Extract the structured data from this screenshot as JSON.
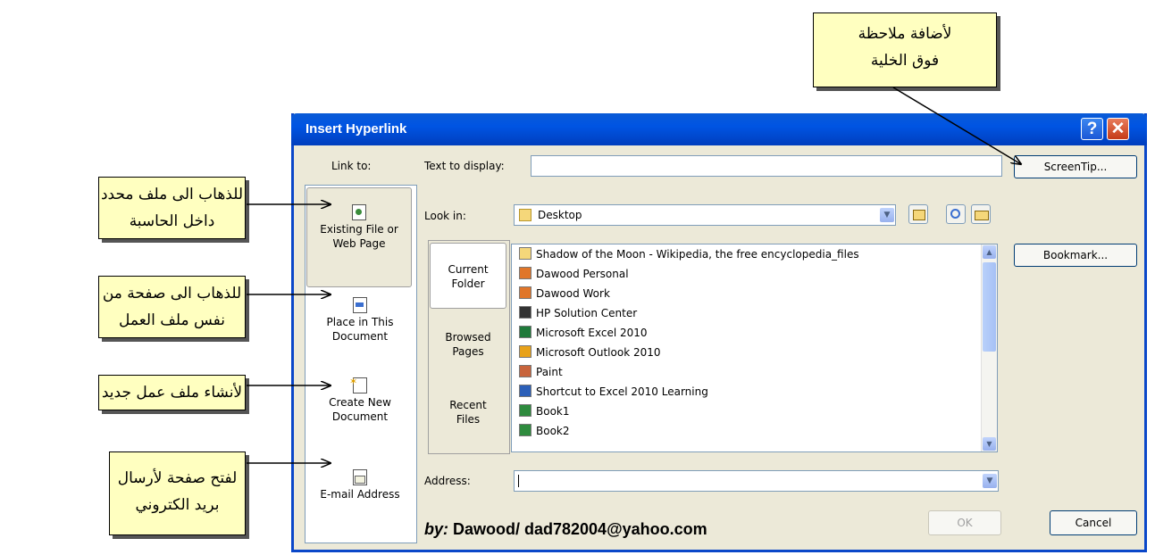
{
  "callouts": {
    "screentip": [
      "لأضافة ملاحظة",
      "فوق الخلية"
    ],
    "existing_file": [
      "للذهاب الى ملف محدد",
      "داخل الحاسبة"
    ],
    "place_in_doc": [
      "للذهاب الى صفحة من",
      "نفس ملف العمل"
    ],
    "new_doc": [
      "لأنشاء ملف عمل جديد"
    ],
    "email": [
      "لفتح صفحة لأرسال",
      "بريد الكتروني"
    ]
  },
  "dialog": {
    "title": "Insert Hyperlink",
    "help_glyph": "?",
    "close_glyph": "✕",
    "link_to_label": "Link to:",
    "text_to_display_label": "Text to display:",
    "text_to_display_value": "",
    "screentip_button": "ScreenTip...",
    "look_in_label": "Look in:",
    "look_in_value": "Desktop",
    "bookmark_button": "Bookmark...",
    "address_label": "Address:",
    "address_value": "",
    "ok_button": "OK",
    "cancel_button": "Cancel",
    "signature_prefix": "by:",
    "signature_text": " Dawood/ dad782004@yahoo.com",
    "sidebar": [
      {
        "line1": "Existing File or",
        "line2": "Web Page",
        "icon": "globe-file-icon"
      },
      {
        "line1": "Place in This",
        "line2": "Document",
        "icon": "document-place-icon"
      },
      {
        "line1": "Create New",
        "line2": "Document",
        "icon": "new-document-icon"
      },
      {
        "line1": "E-mail Address",
        "line2": "",
        "icon": "email-icon"
      }
    ],
    "look_tabs": [
      {
        "line1": "Current",
        "line2": "Folder"
      },
      {
        "line1": "Browsed",
        "line2": "Pages"
      },
      {
        "line1": "Recent",
        "line2": "Files"
      }
    ],
    "files": [
      {
        "name": "Shadow of the Moon - Wikipedia, the free encyclopedia_files",
        "icon": "folder-icon",
        "color": "#f5d77a"
      },
      {
        "name": "Dawood Personal",
        "icon": "shortcut-icon",
        "color": "#e0762a"
      },
      {
        "name": "Dawood Work",
        "icon": "shortcut-icon",
        "color": "#e0762a"
      },
      {
        "name": "HP Solution Center",
        "icon": "hp-icon",
        "color": "#333333"
      },
      {
        "name": "Microsoft Excel 2010",
        "icon": "excel-icon",
        "color": "#1f7a3a"
      },
      {
        "name": "Microsoft Outlook 2010",
        "icon": "outlook-icon",
        "color": "#e8a21a"
      },
      {
        "name": "Paint",
        "icon": "paint-icon",
        "color": "#c8643c"
      },
      {
        "name": "Shortcut to Excel 2010 Learning",
        "icon": "word-icon",
        "color": "#2b5fb8"
      },
      {
        "name": "Book1",
        "icon": "excel-file-icon",
        "color": "#2e8b3e"
      },
      {
        "name": "Book2",
        "icon": "excel-file-icon",
        "color": "#2e8b3e"
      }
    ]
  }
}
